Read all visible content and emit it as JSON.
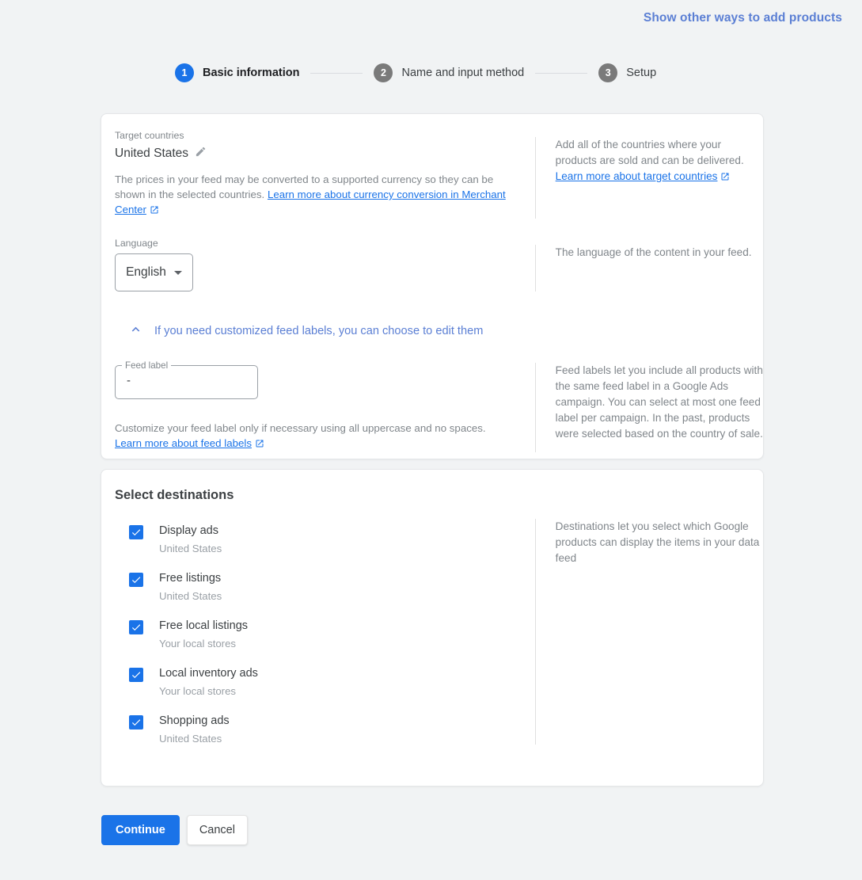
{
  "top": {
    "link_label": "Show other ways to add products"
  },
  "stepper": {
    "steps": [
      {
        "number": "1",
        "label": "Basic information",
        "state": "active"
      },
      {
        "number": "2",
        "label": "Name and input method",
        "state": "inactive"
      },
      {
        "number": "3",
        "label": "Setup",
        "state": "inactive"
      }
    ]
  },
  "basic_card": {
    "target_countries": {
      "label": "Target countries",
      "value": "United States",
      "edit_icon": "pencil-icon",
      "description_prefix": "The prices in your feed may be converted to a supported currency so they can be shown in the selected countries.",
      "description_link": "Learn more about currency conversion in Merchant Center",
      "link_icon": "external-link-icon",
      "help_text": "Add all of the countries where your products are sold and can be delivered.",
      "help_link": "Learn more about target countries"
    },
    "language": {
      "label": "Language",
      "value": "English",
      "caret_icon": "chevron-down-icon",
      "help_text": "The language of the content in your feed."
    },
    "feed_labels_expander": {
      "icon": "chevron-up-icon",
      "label": "If you need customized feed labels, you can choose to edit them"
    },
    "feed_label": {
      "label": "Feed label",
      "value": "-",
      "description_prefix": "Customize your feed label only if necessary using all uppercase and no spaces.",
      "description_link": "Learn more about feed labels",
      "link_icon": "external-link-icon",
      "help_text": "Feed labels let you include all products with the same feed label in a Google Ads campaign. You can select at most one feed label per campaign. In the past, products were selected based on the country of sale."
    }
  },
  "destinations_card": {
    "title": "Select destinations",
    "help_text": "Destinations let you select which Google products can display the items in your data feed",
    "items": [
      {
        "name": "Display ads",
        "sub": "United States",
        "checked": true
      },
      {
        "name": "Free listings",
        "sub": "United States",
        "checked": true
      },
      {
        "name": "Free local listings",
        "sub": "Your local stores",
        "checked": true
      },
      {
        "name": "Local inventory ads",
        "sub": "Your local stores",
        "checked": true
      },
      {
        "name": "Shopping ads",
        "sub": "United States",
        "checked": true
      }
    ]
  },
  "footer": {
    "continue_label": "Continue",
    "cancel_label": "Cancel"
  },
  "colors": {
    "accent_blue": "#1a73e8",
    "link_blue": "#5b7fd4",
    "page_background": "#f1f3f4",
    "inactive_step": "#7a7a7a"
  }
}
